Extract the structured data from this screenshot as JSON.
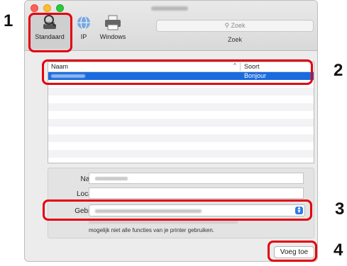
{
  "toolbar": {
    "standard_label": "Standaard",
    "ip_label": "IP",
    "windows_label": "Windows"
  },
  "search": {
    "placeholder": "Zoek",
    "label": "Zoek"
  },
  "list": {
    "col_name": "Naam",
    "col_sort_indicator": "^",
    "col_kind": "Soort",
    "rows": [
      {
        "kind": "Bonjour",
        "selected": true
      }
    ]
  },
  "form": {
    "name_label": "Naam:",
    "location_label": "Locatie:",
    "use_label": "Gebruik:",
    "note": "mogelijk niet alle functies van je printer gebruiken."
  },
  "actions": {
    "add_label": "Voeg toe"
  },
  "callouts": [
    "1",
    "2",
    "3",
    "4"
  ],
  "colors": {
    "callout": "#e3000f",
    "selection": "#1b6bdf"
  }
}
